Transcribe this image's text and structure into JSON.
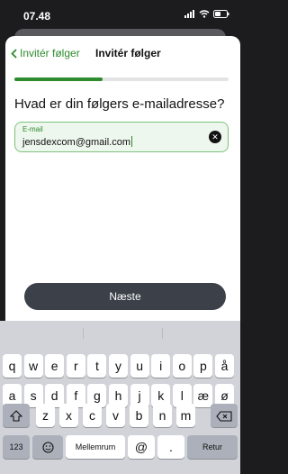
{
  "status_bar": {
    "time": "07.48"
  },
  "nav": {
    "back_label": "Invitér følger",
    "title": "Invitér følger"
  },
  "progress": {
    "fraction": 0.41
  },
  "question": "Hvad er din følgers e-mailadresse?",
  "email": {
    "label": "E-mail",
    "value": "jensdexcom@gmail.com"
  },
  "next_button": "Næste",
  "keyboard": {
    "row1": [
      "q",
      "w",
      "e",
      "r",
      "t",
      "y",
      "u",
      "i",
      "o",
      "p",
      "å"
    ],
    "row2": [
      "a",
      "s",
      "d",
      "f",
      "g",
      "h",
      "j",
      "k",
      "l",
      "æ",
      "ø"
    ],
    "row3": [
      "z",
      "x",
      "c",
      "v",
      "b",
      "n",
      "m"
    ],
    "numbers_key": "123",
    "space_key": "Mellemrum",
    "at_key": "@",
    "dot_key": ".",
    "return_key": "Retur"
  },
  "colors": {
    "accent": "#2e8b2e",
    "button": "#3b4049"
  }
}
